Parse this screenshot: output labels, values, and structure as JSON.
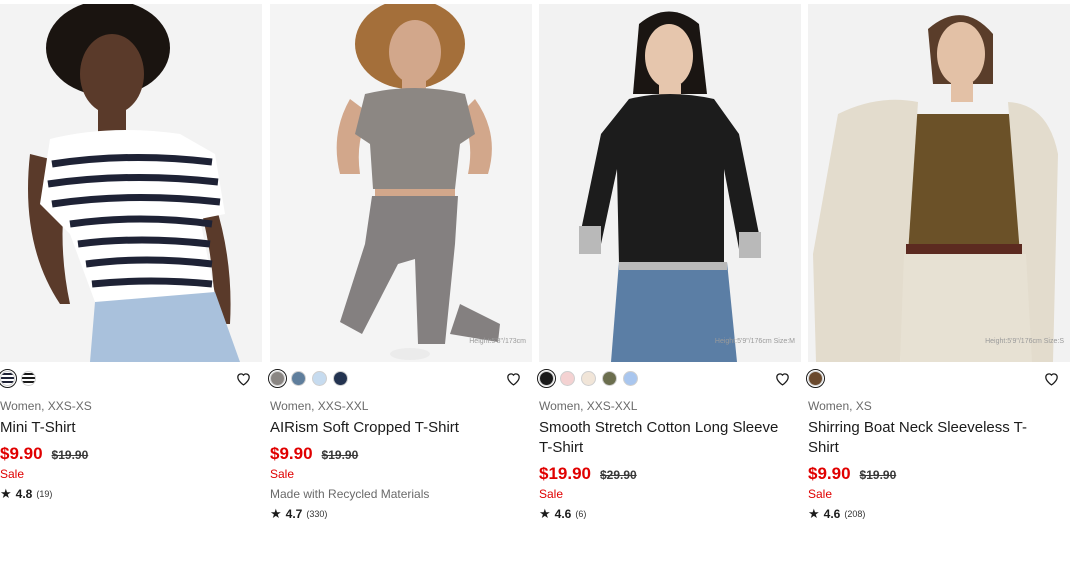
{
  "products": [
    {
      "gender_size": "Women, XXS-XS",
      "name": "Mini T-Shirt",
      "price": "$9.90",
      "original_price": "$19.90",
      "sale_label": "Sale",
      "flag": "",
      "rating": "4.8",
      "review_count": "(19)",
      "height_tag": "",
      "swatches": [
        "stripe-white-navy",
        "stripe-black-white"
      ],
      "colors": {
        "top": "#ffffff",
        "stripe": "#1e2235",
        "bottom": "#a9c1dc",
        "skin": "#5a3a2a",
        "hair": "#1a1410"
      }
    },
    {
      "gender_size": "Women, XXS-XXL",
      "name": "AIRism Soft Cropped T-Shirt",
      "price": "$9.90",
      "original_price": "$19.90",
      "sale_label": "Sale",
      "flag": "Made with Recycled Materials",
      "rating": "4.7",
      "review_count": "(330)",
      "height_tag": "Height:5'8\"/173cm",
      "swatches": [
        "#8a8683",
        "#5f7e9c",
        "#c6dbef",
        "#233350"
      ],
      "colors": {
        "top": "#8c8783",
        "bottom": "#848080",
        "skin": "#d2a78b",
        "hair": "#a46f3a"
      }
    },
    {
      "gender_size": "Women, XXS-XXL",
      "name": "Smooth Stretch Cotton Long Sleeve T-Shirt",
      "price": "$19.90",
      "original_price": "$29.90",
      "sale_label": "Sale",
      "flag": "",
      "rating": "4.6",
      "review_count": "(6)",
      "height_tag": "Height:5'9\"/176cm Size:M",
      "swatches": [
        "#1a1a1a",
        "#f4d2d2",
        "#f1e5d8",
        "#6b6e4e",
        "#a9c6ee"
      ],
      "colors": {
        "top": "#1c1c1c",
        "bottom": "#5b7ea5",
        "skin": "#e6c6ad",
        "hair": "#1a1512"
      }
    },
    {
      "gender_size": "Women, XS",
      "name": "Shirring Boat Neck Sleeveless T-Shirt",
      "price": "$9.90",
      "original_price": "$19.90",
      "sale_label": "Sale",
      "flag": "",
      "rating": "4.6",
      "review_count": "(208)",
      "height_tag": "Height:5'9\"/176cm Size:S",
      "swatches": [
        "#6b4a2e"
      ],
      "colors": {
        "top": "#6b5128",
        "jacket": "#e3dccd",
        "bottom": "#e7e1d3",
        "skin": "#e3c1a6",
        "hair": "#5a3d2a"
      }
    }
  ],
  "icons": {
    "wishlist": "heart-outline-icon",
    "rating": "star-icon"
  }
}
